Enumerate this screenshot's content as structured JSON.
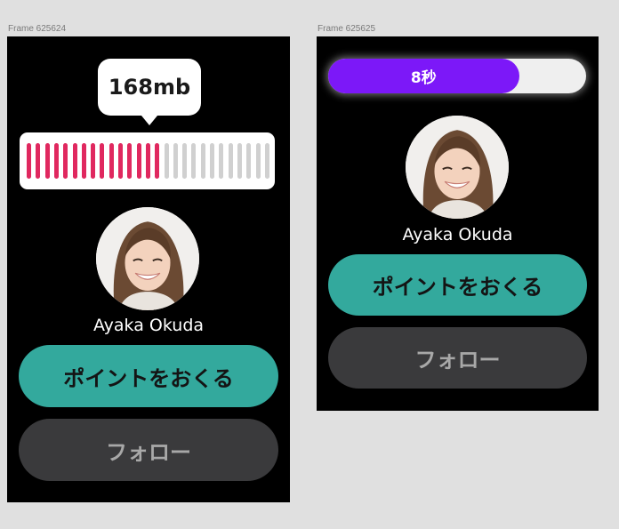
{
  "frames": [
    {
      "label": "Frame 625624",
      "size_badge": "168mb",
      "meter": {
        "total_bars": 27,
        "filled_bars": 15,
        "filled_color": "#e0285f",
        "empty_color": "#d0d0d0"
      },
      "profile": {
        "name": "Ayaka Okuda",
        "avatar": "profile-photo"
      },
      "send_points_label": "ポイントをおくる",
      "follow_label": "フォロー"
    },
    {
      "label": "Frame 625625",
      "timer": {
        "label": "8秒",
        "progress_fraction": 0.74,
        "fill_color": "#7c18f8"
      },
      "profile": {
        "name": "Ayaka Okuda",
        "avatar": "profile-photo"
      },
      "send_points_label": "ポイントをおくる",
      "follow_label": "フォロー"
    }
  ],
  "colors": {
    "canvas_bg": "#e0e0e0",
    "frame_bg": "#000000",
    "point_button": "#33a99d",
    "follow_button": "#3a3a3c"
  }
}
